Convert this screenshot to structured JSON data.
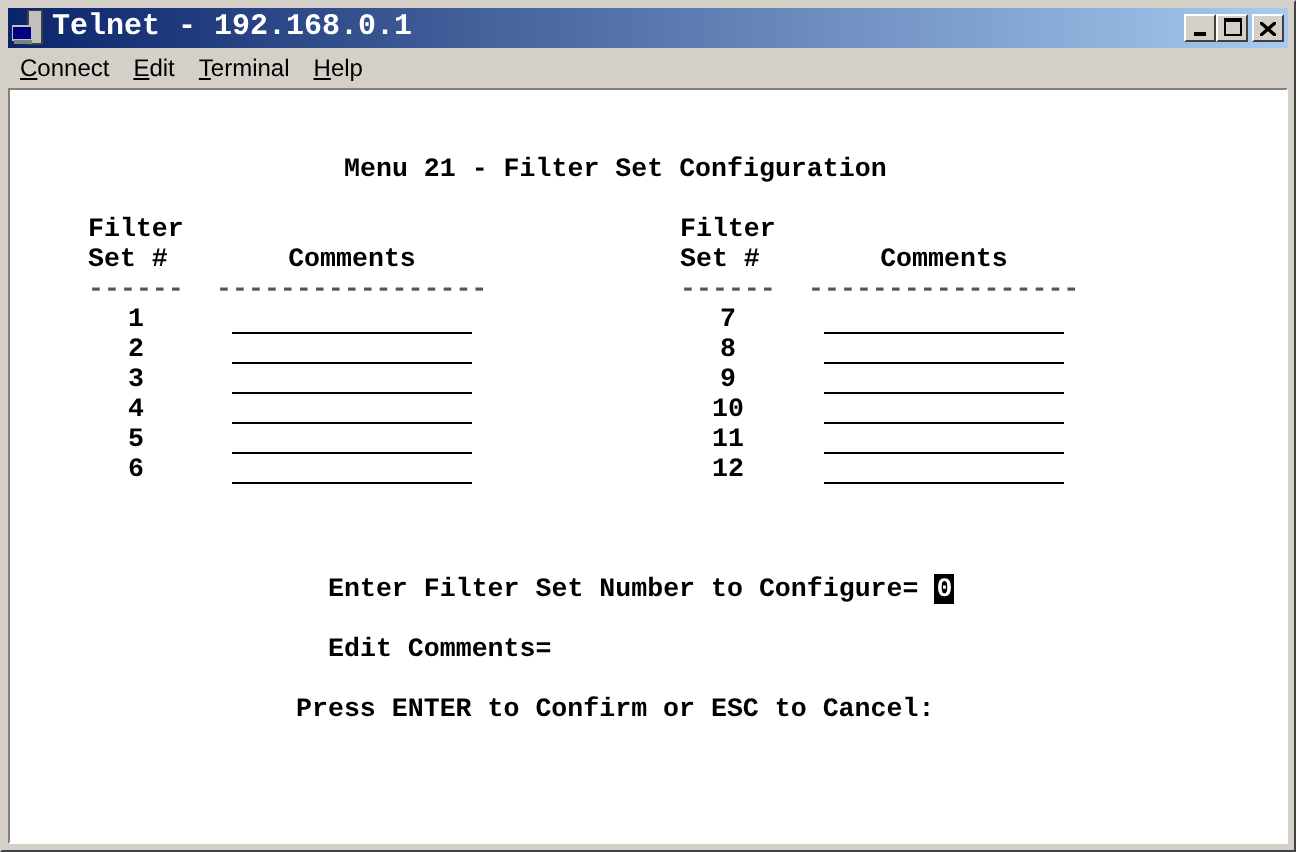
{
  "window": {
    "title": "Telnet - 192.168.0.1"
  },
  "menu": [
    "Connect",
    "Edit",
    "Terminal",
    "Help"
  ],
  "terminal": {
    "title": "Menu 21 - Filter Set Configuration",
    "tables": [
      {
        "header_1": "Filter",
        "header_2": "Set #",
        "header_3": "Comments",
        "rule_1": "------",
        "rule_2": "-----------------",
        "rows": [
          "1",
          "2",
          "3",
          "4",
          "5",
          "6"
        ]
      },
      {
        "header_1": "Filter",
        "header_2": "Set #",
        "header_3": "Comments",
        "rule_1": "------",
        "rule_2": "-----------------",
        "rows": [
          "7",
          "8",
          "9",
          "10",
          "11",
          "12"
        ]
      }
    ],
    "prompt": {
      "label": "Enter Filter Set Number to Configure=",
      "value": "0"
    },
    "edit_comments": "Edit Comments=",
    "footer": "Press ENTER to Confirm or ESC to Cancel:"
  }
}
